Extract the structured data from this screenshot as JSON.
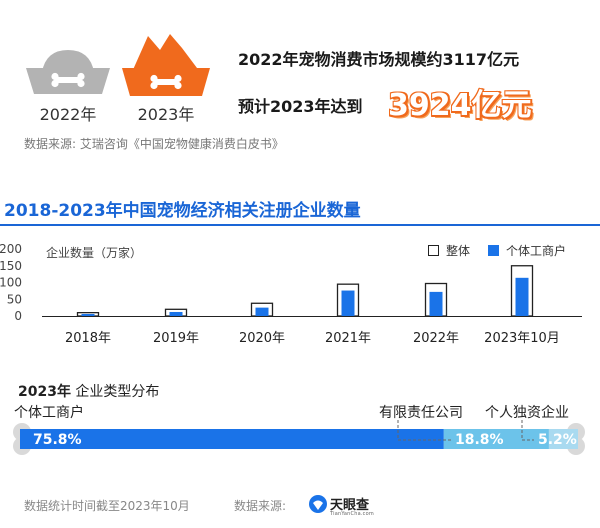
{
  "header": {
    "bowls": [
      {
        "label": "2022年",
        "color": "#b3b3b3"
      },
      {
        "label": "2023年",
        "color": "#f06a1d"
      }
    ],
    "line1": "2022年宠物消费市场规模约3117亿元",
    "line2": "预计2023年达到",
    "big_number": "3924亿元",
    "source": "数据来源: 艾瑞咨询《中国宠物健康消费白皮书》"
  },
  "section_title": "2018-2023年中国宠物经济相关注册企业数量",
  "colors": {
    "accent": "#1a66d6",
    "bar_fill": "#1a73e8",
    "orange": "#f06a1d",
    "light_blue": "#6cc3ea",
    "pale_blue": "#a9daf0",
    "bone": "#d9d9d9"
  },
  "chart_data": [
    {
      "type": "bar",
      "title": "",
      "ylabel": "企业数量（万家）",
      "ylim": [
        0,
        200
      ],
      "yticks": [
        "200",
        "150",
        "100",
        "50",
        "0"
      ],
      "categories": [
        "2018年",
        "2019年",
        "2020年",
        "2021年",
        "2022年",
        "2023年10月"
      ],
      "legend_position": "top-right",
      "series": [
        {
          "name": "整体",
          "values": [
            10,
            20,
            38,
            95,
            97,
            150
          ]
        },
        {
          "name": "个体工商户",
          "values": [
            6,
            12,
            25,
            76,
            72,
            114
          ]
        }
      ]
    },
    {
      "type": "bar",
      "title": "2023年 企业类型分布",
      "title_year": "2023年",
      "title_rest": "企业类型分布",
      "orientation": "horizontal-stacked",
      "categories": [
        "个体工商户",
        "有限责任公司",
        "个人独资企业"
      ],
      "values": [
        75.8,
        18.8,
        5.2
      ],
      "labels": [
        "75.8%",
        "18.8%",
        "5.2%"
      ]
    }
  ],
  "footer": {
    "cutoff": "数据统计时间截至2023年10月",
    "source_label": "数据来源:",
    "brand": "天眼查",
    "brand_sub": "TianYanCha.com"
  }
}
